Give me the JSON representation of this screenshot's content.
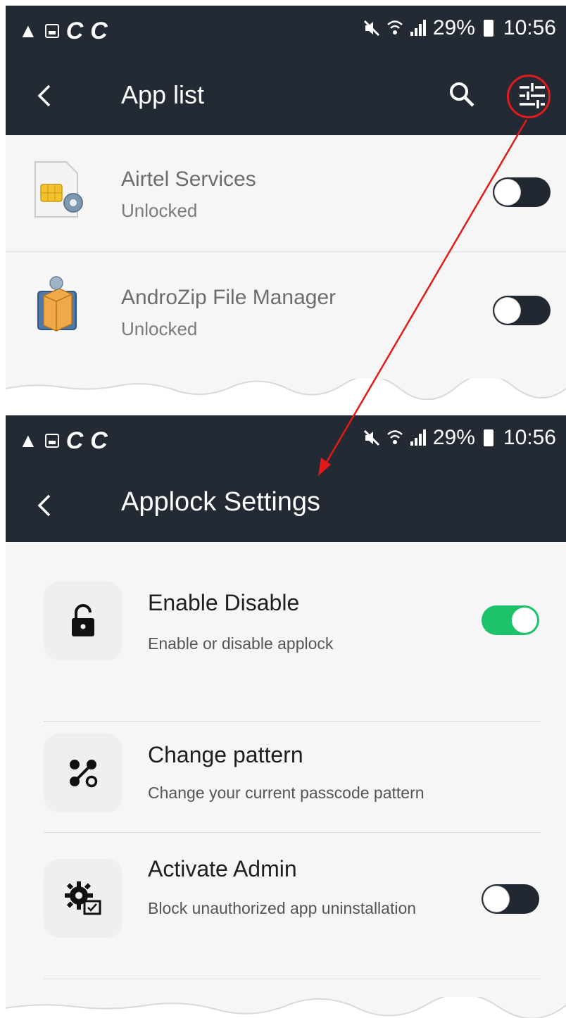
{
  "top_screen": {
    "status_bar": {
      "left_icons": [
        "warning-icon",
        "image-notification-icon",
        "c-notification-icon",
        "c-notification-icon"
      ],
      "right_icons": [
        "mute-icon",
        "wifi-icon",
        "signal-icon"
      ],
      "battery": "29%",
      "time": "10:56"
    },
    "app_bar": {
      "title": "App list"
    },
    "apps": [
      {
        "name": "Airtel Services",
        "status": "Unlocked",
        "icon": "sim-card-gear-icon",
        "locked": false
      },
      {
        "name": "AndroZip File Manager",
        "status": "Unlocked",
        "icon": "package-box-icon",
        "locked": false
      }
    ]
  },
  "bottom_screen": {
    "status_bar": {
      "left_icons": [
        "warning-icon",
        "image-notification-icon",
        "c-notification-icon",
        "c-notification-icon"
      ],
      "right_icons": [
        "mute-icon",
        "wifi-icon",
        "signal-icon"
      ],
      "battery": "29%",
      "time": "10:56"
    },
    "app_bar": {
      "title": "Applock Settings"
    },
    "settings": [
      {
        "title": "Enable Disable",
        "description": "Enable or disable applock",
        "icon": "lock-icon",
        "toggle": true
      },
      {
        "title": "Change pattern",
        "description": "Change your current passcode pattern",
        "icon": "pattern-icon"
      },
      {
        "title": "Activate Admin",
        "description": "Block unauthorized app uninstallation",
        "icon": "admin-gear-icon",
        "toggle": false
      }
    ]
  },
  "colors": {
    "header": "#232a33",
    "toggle_on": "#1ec26a",
    "toggle_off": "#222831",
    "annotation": "#e21a1a"
  }
}
